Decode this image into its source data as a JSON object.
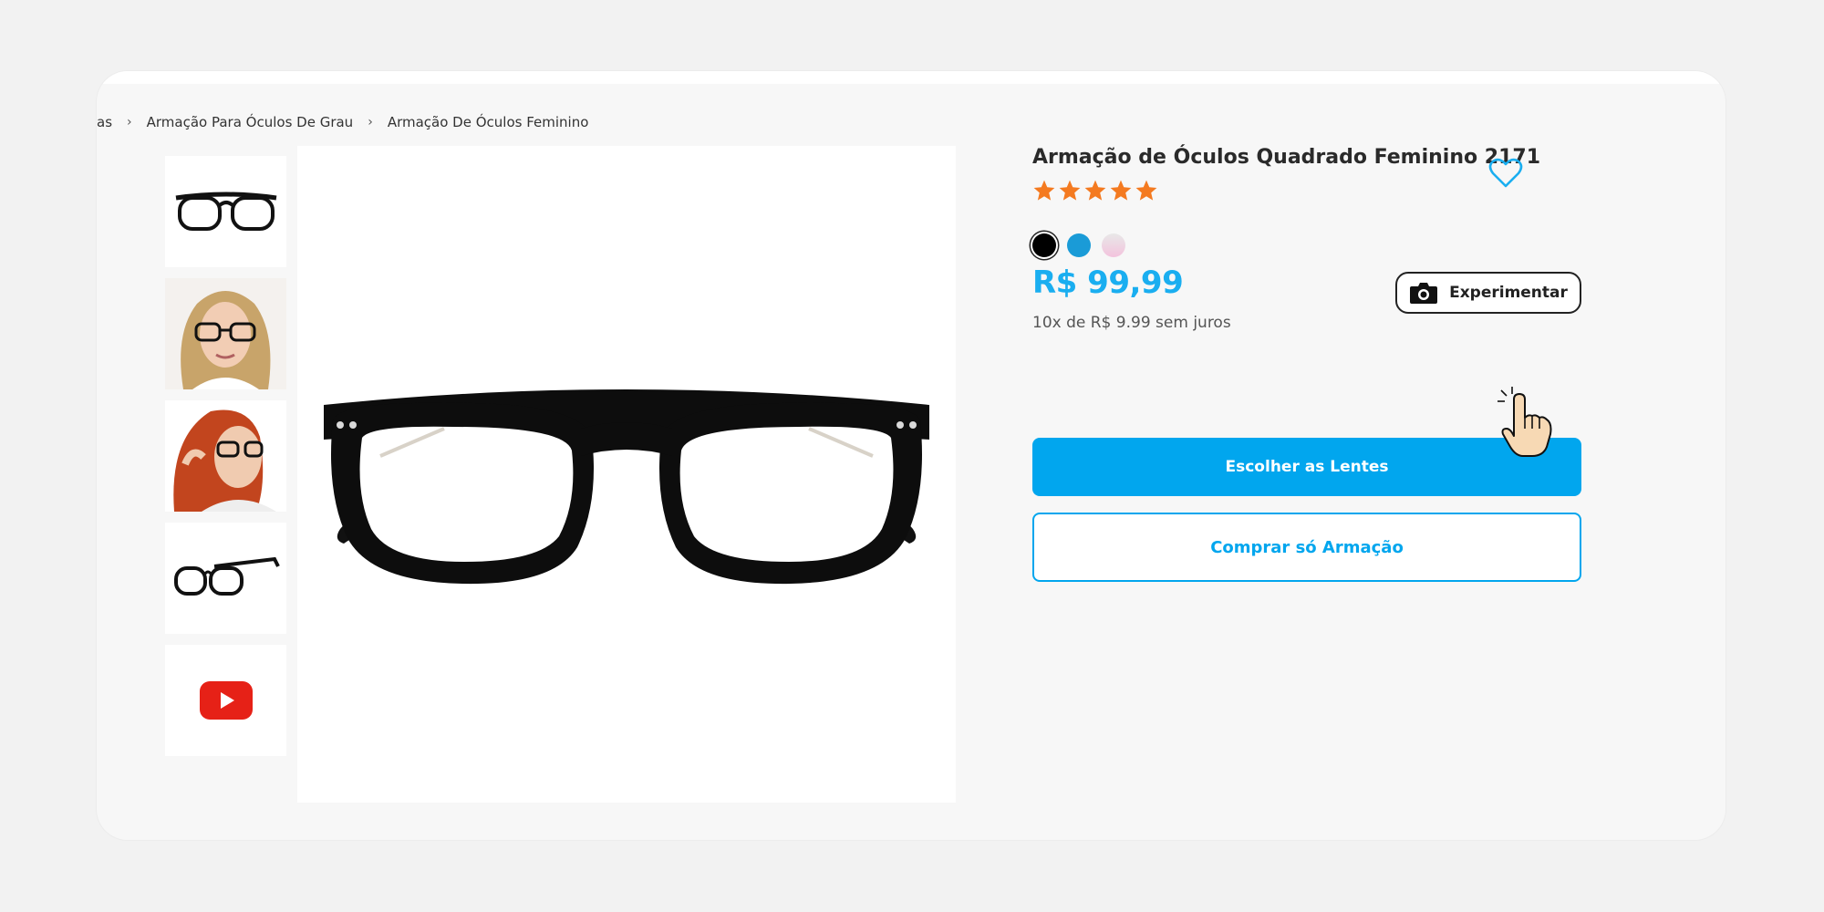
{
  "breadcrumb": {
    "items": [
      "as",
      "Armação Para Óculos De Grau",
      "Armação De Óculos Feminino"
    ],
    "separator": "›"
  },
  "gallery": {
    "thumbnails": [
      {
        "icon": "glasses-front-thumbnail"
      },
      {
        "icon": "model-blonde-wearing-glasses"
      },
      {
        "icon": "model-redhead-wearing-glasses"
      },
      {
        "icon": "glasses-angle-thumbnail"
      },
      {
        "icon": "youtube-play-icon"
      }
    ],
    "main_icon": "glasses-front-image"
  },
  "product": {
    "title": "Armação de Óculos Quadrado Feminino 2171",
    "rating": 5,
    "rating_max": 5,
    "colors": [
      "#000000",
      "#1a9bd7",
      "#f3c3dd"
    ],
    "selected_color_index": 0,
    "price": "R$ 99,99",
    "installments": "10x de R$ 9.99 sem juros"
  },
  "actions": {
    "try_on_label": "Experimentar",
    "choose_lenses_label": "Escolher as Lentes",
    "buy_frame_only_label": "Comprar só Armação"
  },
  "colors": {
    "accent": "#01a6ee",
    "price": "#1aaef0",
    "star": "#f47a20",
    "youtube_red": "#e62117"
  }
}
